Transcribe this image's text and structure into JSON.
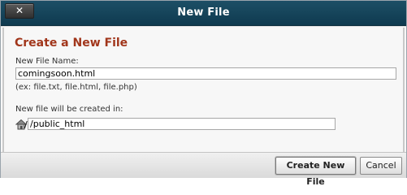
{
  "window": {
    "title": "New File",
    "close_label": "✕"
  },
  "form": {
    "heading": "Create a New File",
    "file_name_label": "New File Name:",
    "file_name_value": "comingsoon.html",
    "file_name_hint": "(ex: file.txt, file.html, file.php)",
    "directory_label": "New file will be created in:",
    "directory_prefix": "/",
    "directory_value": "/public_html",
    "directory_icon": "home-icon"
  },
  "footer": {
    "create_label": "Create New File",
    "cancel_label": "Cancel"
  }
}
